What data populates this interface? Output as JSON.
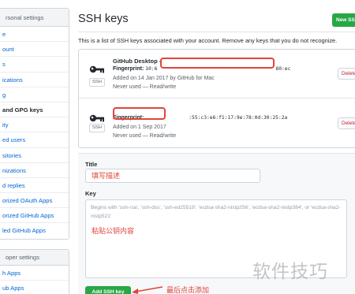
{
  "sidebar": {
    "personal_header": "rsonal settings",
    "items": [
      {
        "label": "e"
      },
      {
        "label": "ount"
      },
      {
        "label": "s"
      },
      {
        "label": "ications"
      },
      {
        "label": "g"
      },
      {
        "label": "and GPG keys",
        "active": true
      },
      {
        "label": "ity"
      },
      {
        "label": "ed users"
      },
      {
        "label": "sitories"
      },
      {
        "label": "nizations"
      },
      {
        "label": "d replies"
      },
      {
        "label": "orized OAuth Apps"
      },
      {
        "label": "orized GitHub Apps"
      },
      {
        "label": "led GitHub Apps"
      }
    ],
    "developer_header": "oper settings",
    "dev_items": [
      {
        "label": "h Apps"
      },
      {
        "label": "ub Apps"
      }
    ]
  },
  "header": {
    "title": "SSH keys",
    "new_button": "New SSH"
  },
  "intro": "This is a list of SSH keys associated with your account. Remove any keys that you do not recognize.",
  "keys": [
    {
      "name": "GitHub Desktop - ",
      "fingerprint_label": "Fingerprint:",
      "fingerprint": "10:6",
      "fingerprint_tail": "80:ec",
      "added": "Added on 14 Jan 2017 by GitHub for Mac",
      "usage": "Never used — Read/write",
      "badge": "SSH",
      "delete": "Delete"
    },
    {
      "name": "",
      "fingerprint_label": "Fingerprint:",
      "fingerprint": "",
      "fingerprint_tail": ":55:c3:e6:f1:17:9e:78:0d:30:25:2a",
      "added": "Added on 1 Sep 2017",
      "usage": "Never used — Read/write",
      "badge": "SSH",
      "delete": "Delete"
    }
  ],
  "form": {
    "title_label": "Title",
    "title_value": "填写描述",
    "key_label": "Key",
    "key_placeholder": "Begins with 'ssh-rsa', 'ssh-dss', 'ssh-ed25519', 'ecdsa-sha2-nistp256', 'ecdsa-sha2-nistp384', or 'ecdsa-sha2-nistp521'",
    "paste_note": "粘贴公钥内容",
    "add_button": "Add SSH key",
    "click_note": "最后点击添加"
  },
  "watermark": "软件技巧",
  "colors": {
    "link": "#0366d6",
    "green": "#28a745",
    "annotation_red": "#e0443a",
    "delete_red": "#cb2431"
  },
  "icons": {
    "key": "key-icon"
  }
}
